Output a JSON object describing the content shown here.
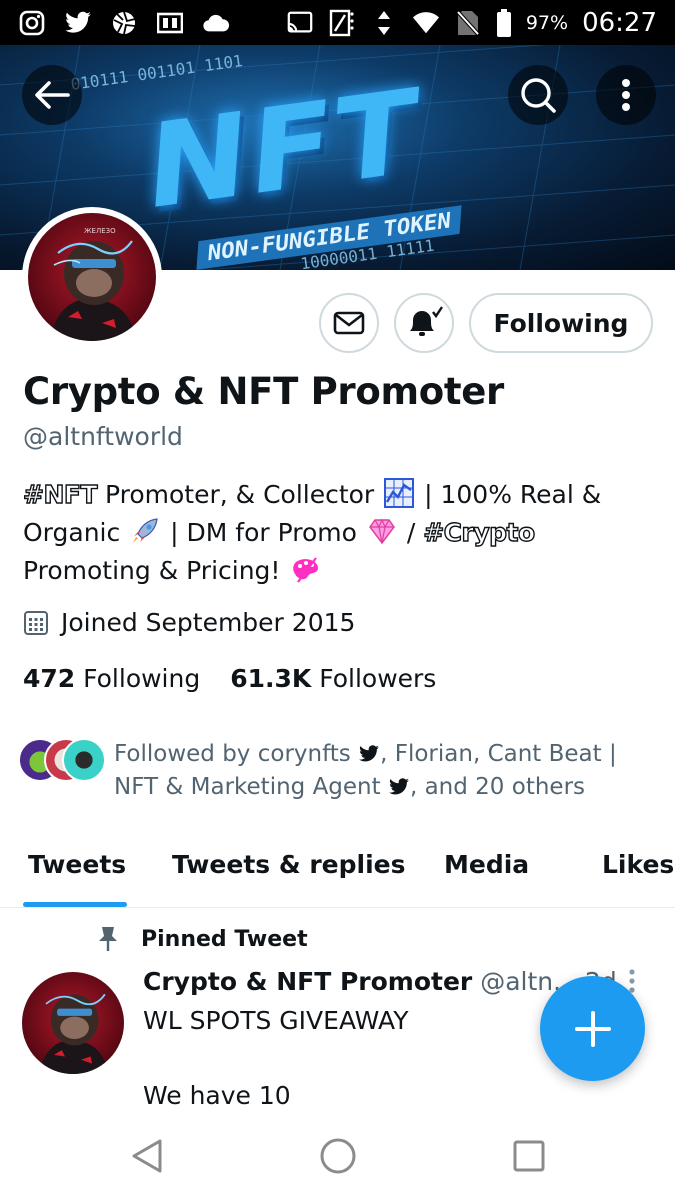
{
  "status_bar": {
    "battery_pct": "97%",
    "time": "06:27",
    "left_icons": [
      "instagram-icon",
      "twitter-icon",
      "aperture-icon",
      "flipboard-icon",
      "cloud-icon"
    ],
    "right_icons": [
      "cast-icon",
      "nfc-icon",
      "data-arrows-icon",
      "wifi-icon",
      "no-sim-icon",
      "battery-icon"
    ]
  },
  "banner": {
    "big_text": "NFT",
    "sub_text": "NON-FUNGIBLE TOKEN",
    "bits_top": "010111 001101 1101",
    "bits_bottom": "10000011 11111"
  },
  "profile": {
    "name": "Crypto & NFT Promoter",
    "handle": "@altnftworld",
    "bio": {
      "hashtag1": "#NFT",
      "part1": " Promoter, & Collector ",
      "part2": " | 100% Real & Organic ",
      "part3": " | DM for Promo ",
      "part4": " / ",
      "hashtag2": "#Crypto",
      "part5": " Promoting & Pricing! "
    },
    "joined": "Joined September 2015",
    "following_count": "472",
    "following_label": "Following",
    "followers_count": "61.3K",
    "followers_label": "Followers",
    "followed_by_1": "Followed by corynfts",
    "followed_by_2": ", Florian, Cant Beat | NFT & Marketing Agent",
    "followed_by_3": ", and 20 others",
    "following_button": "Following"
  },
  "tabs": [
    {
      "label": "Tweets",
      "active": true
    },
    {
      "label": "Tweets & replies"
    },
    {
      "label": "Media"
    },
    {
      "label": "Likes"
    }
  ],
  "tweet": {
    "pinned_label": "Pinned Tweet",
    "author_name": "Crypto & NFT Promoter",
    "author_handle": "@altn...",
    "time": "2d",
    "line1": "WL SPOTS GIVEAWAY",
    "line2": "We have 10"
  },
  "colors": {
    "accent": "#1d9bf0",
    "text": "#0f1419",
    "muted": "#536471",
    "border": "#cfd9de"
  }
}
